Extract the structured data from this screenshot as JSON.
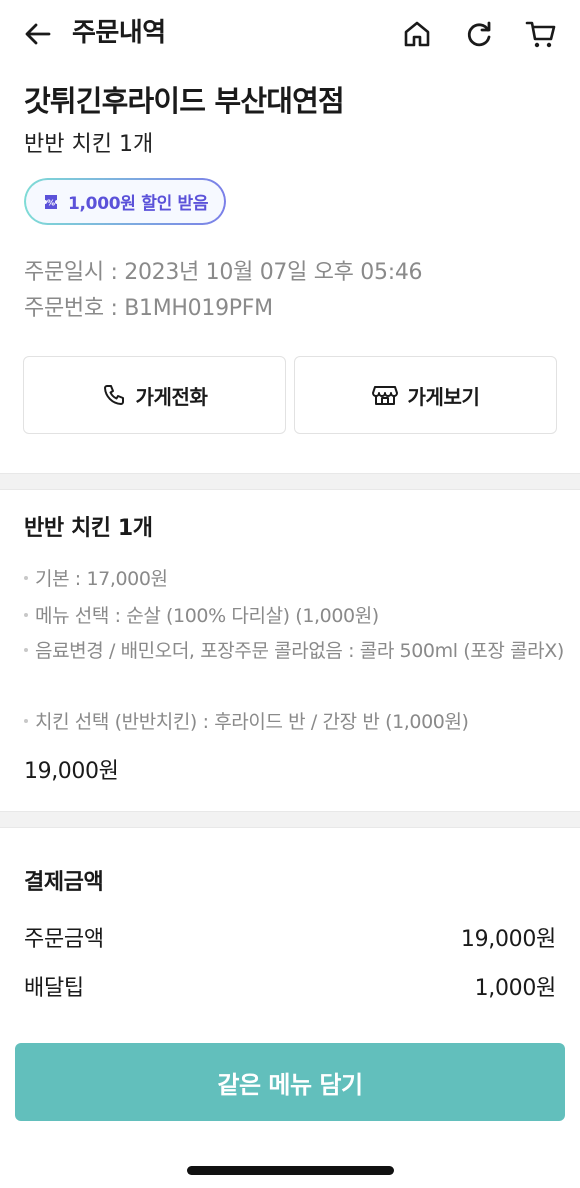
{
  "header": {
    "title": "주문내역",
    "icons": [
      "back-arrow-icon",
      "home-icon",
      "refresh-icon",
      "cart-icon"
    ]
  },
  "store": {
    "name": "갓튀긴후라이드 부산대연점",
    "order_summary": "반반 치킨 1개",
    "discount_badge": "1,000원 할인 받음"
  },
  "order_meta": {
    "datetime": "주문일시 : 2023년 10월 07일 오후 05:46",
    "number": "주문번호 : B1MH019PFM"
  },
  "actions": {
    "call_label": "가게전화",
    "view_label": "가게보기"
  },
  "item": {
    "title": "반반 치킨 1개",
    "options": [
      "기본 : 17,000원",
      "메뉴 선택 : 순살 (100% 다리살) (1,000원)",
      "음료변경 / 배민오더, 포장주문 콜라없음 : 콜라 500ml (포장 콜라X)",
      "치킨 선택 (반반치킨) : 후라이드 반 / 간장 반 (1,000원)"
    ],
    "price": "19,000원"
  },
  "payment": {
    "title": "결제금액",
    "rows": [
      {
        "label": "주문금액",
        "value": "19,000원"
      },
      {
        "label": "배달팁",
        "value": "1,000원"
      }
    ]
  },
  "cta": {
    "label": "같은 메뉴 담기"
  },
  "colors": {
    "accent": "#62bfbc",
    "badge_text": "#5b52d9",
    "muted_text": "#8a8a8a"
  }
}
